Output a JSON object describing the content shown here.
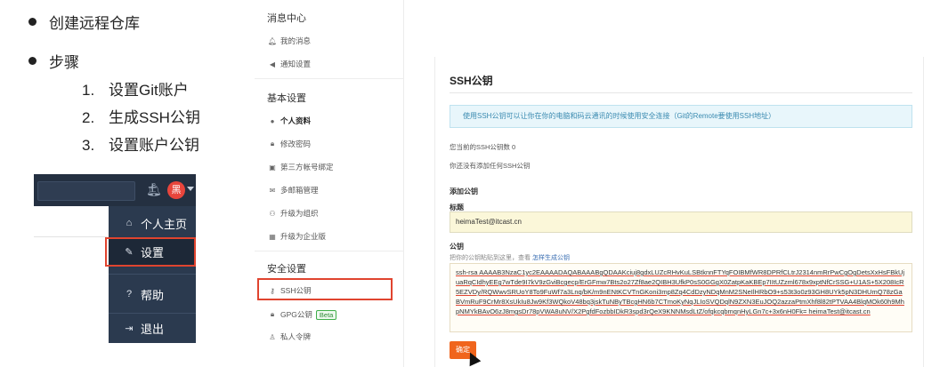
{
  "slide": {
    "bullets": [
      "创建远程仓库",
      "步骤"
    ],
    "steps": [
      {
        "num": "1.",
        "label": "设置Git账户"
      },
      {
        "num": "2.",
        "label": "生成SSH公钥"
      },
      {
        "num": "3.",
        "label": "设置账户公钥"
      }
    ],
    "mini": {
      "avatar": "黑",
      "menu": [
        "个人主页",
        "设置",
        "帮助",
        "退出"
      ]
    }
  },
  "sidebar": {
    "sections": [
      {
        "title": "消息中心",
        "items": [
          "我的消息",
          "通知设置"
        ]
      },
      {
        "title": "基本设置",
        "items": [
          "个人资料",
          "修改密码",
          "第三方帐号绑定",
          "多邮箱管理",
          "升级为组织",
          "升级为企业版"
        ]
      },
      {
        "title": "安全设置",
        "items": [
          "SSH公钥",
          "GPG公钥",
          "私人令牌"
        ]
      }
    ],
    "beta": "Beta"
  },
  "main": {
    "title": "SSH公钥",
    "info": "使用SSH公钥可以让你在你的电脑和码云通讯的时候使用安全连接（Git的Remote要使用SSH地址）",
    "count": "您当前的SSH公钥数 0",
    "none": "你还没有添加任何SSH公钥",
    "add_title": "添加公钥",
    "title_label": "标题",
    "title_value": "heimaTest@itcast.cn",
    "key_label": "公钥",
    "key_hint": "把你的公钥粘贴到这里，查看",
    "key_hint_link": "怎样生成公钥",
    "key_value": "ssh-rsa AAAAB3NzaC1yc2EAAAADAQABAAABgQDAAKciuj8gdxLUZcRHvKuLSBtknnFTYqFOIBMfWR8DPRfCLtrJ2314nmRrPwCgOgDetsXxHsFBkUjuaRqCIdhyEEg7wTde9I7kV9zGviBcgecp/ErGFmw7Bts2o27Zf8ae2QIBH3UfkP0sS0GGgX0ZatpKaKBEp7IItUZzml678x9xptNfCrSSG+U1AS+5X208IcR5EZVDy/RQWwvSRUoY8To9FuWf7a3Lnq/bK/m9nENtKCVTnGKoni3mp8Zq4CdDzyNDqMnM2SNeIlHRbO9+s53t3o0z93GH8UYk5pN3DHUmQ78zGaBVmRuF9CrMr8XsUkIu8Jw9Kf3WQkoV48bq3jskTuNByTBcgHN6b7CTmoKyNqJLIoSVQDqlN9ZXN3EuJOQ2azzaPtmXhf8l82tPTVAA4BlqMOk60h9MhpNMYkBAvO6zJ8mgsDr78pVWA8uNV/X2PgfdFozbbIDkR3spd3rQeX9KNNMsdLtZ/ofqkcqbmqnHyLGn7c+3x6nH0Fk= heimaTest@itcast.cn",
    "confirm": "确定"
  },
  "colors": {
    "accent": "#f0651d",
    "highlight": "#e0442f",
    "nav": "#2b3a4f"
  }
}
